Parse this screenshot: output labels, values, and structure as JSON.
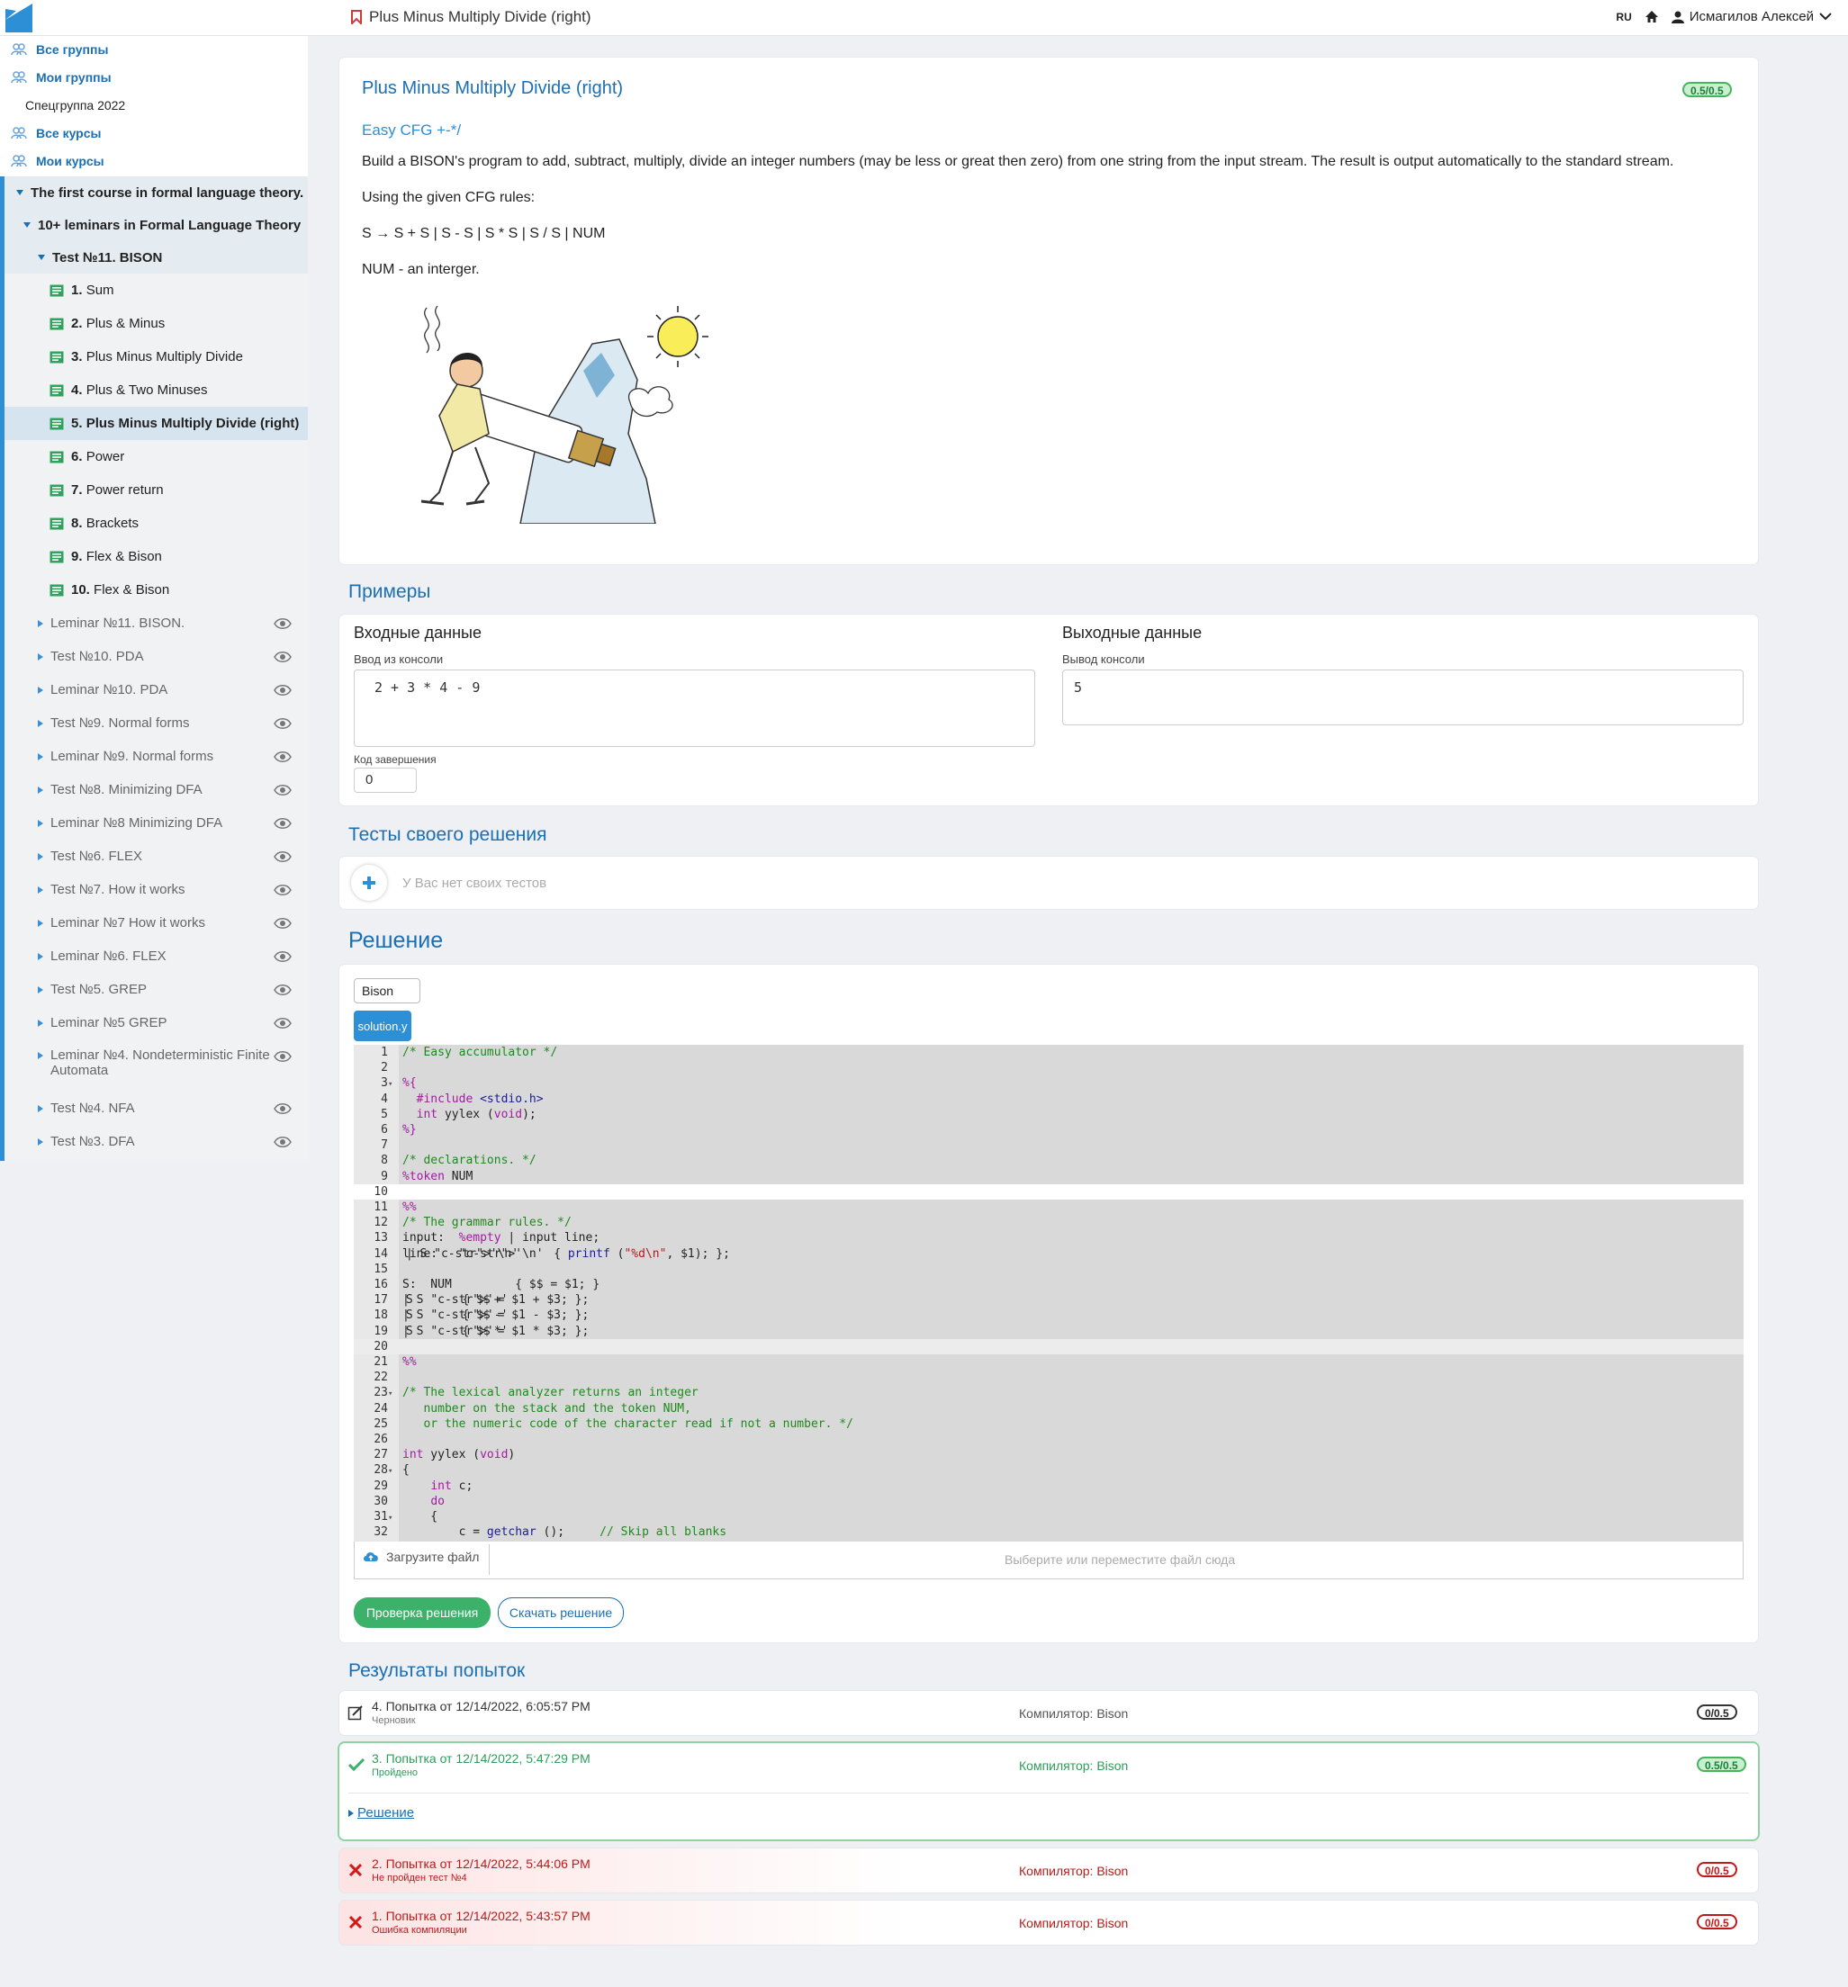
{
  "header": {
    "page_title": "Plus Minus Multiply Divide (right)",
    "lang": "RU",
    "user_name": "Исмагилов Алексей"
  },
  "sidebar": {
    "top_links": [
      "Все группы",
      "Мои группы"
    ],
    "group_name": "Спецгруппа 2022",
    "course_links": [
      "Все курсы",
      "Мои курсы"
    ],
    "course": "The first course in formal language theory.",
    "module": "10+ leminars in Formal Language Theory",
    "test": "Test №11. BISON",
    "tasks": [
      {
        "num": "1.",
        "name": "Sum"
      },
      {
        "num": "2.",
        "name": "Plus & Minus"
      },
      {
        "num": "3.",
        "name": "Plus Minus Multiply Divide"
      },
      {
        "num": "4.",
        "name": "Plus & Two Minuses"
      },
      {
        "num": "5.",
        "name": "Plus Minus Multiply Divide (right)"
      },
      {
        "num": "6.",
        "name": "Power"
      },
      {
        "num": "7.",
        "name": "Power return"
      },
      {
        "num": "8.",
        "name": "Brackets"
      },
      {
        "num": "9.",
        "name": "Flex & Bison"
      },
      {
        "num": "10.",
        "name": "Flex & Bison"
      }
    ],
    "other_items": [
      "Leminar №11. BISON.",
      "Test №10. PDA",
      "Leminar №10. PDA",
      "Test №9. Normal forms",
      "Leminar №9. Normal forms",
      "Test №8. Minimizing DFA",
      "Leminar №8 Minimizing DFA",
      "Test №6. FLEX",
      "Test №7. How it works",
      "Leminar №7 How it works",
      "Leminar №6. FLEX",
      "Test №5. GREP",
      "Leminar №5 GREP",
      "Leminar №4. Nondeterministic Finite",
      "Test №4. NFA",
      "Test №3. DFA"
    ],
    "other_item_wrap": "Automata"
  },
  "task": {
    "title": "Plus Minus Multiply Divide (right)",
    "score": "0.5/0.5",
    "subtitle": "Easy CFG +-*/",
    "description": "Build a BISON's program to add, subtract, multiply, divide an integer numbers (may be less or great then zero) from one string from the input stream. The result is output automatically to the standard stream.",
    "rules_intro": "Using the given CFG rules:",
    "rules": "S → S + S | S - S | S * S | S / S | NUM",
    "num_def": "NUM - an interger."
  },
  "examples": {
    "section_title": "Примеры",
    "input_head": "Входные данные",
    "input_label": "Ввод из консоли",
    "input_value": "2 + 3 * 4 - 9",
    "exit_code_label": "Код завершения",
    "exit_code": "0",
    "output_head": "Выходные данные",
    "output_label": "Вывод консоли",
    "output_value": "5"
  },
  "own_tests": {
    "section_title": "Тесты своего решения",
    "empty_text": "У Вас нет своих тестов"
  },
  "solution": {
    "section_title": "Решение",
    "language": "Bison",
    "file_tab": "solution.y",
    "upload_label": "Загрузите файл",
    "drop_placeholder": "Выберите или переместите файл сюда",
    "check_button": "Проверка решения",
    "download_button": "Скачать решение"
  },
  "code_lines": [
    {
      "n": "1",
      "f": "",
      "t": "/* Easy accumulator */"
    },
    {
      "n": "2",
      "f": "",
      "t": ""
    },
    {
      "n": "3",
      "f": "▾",
      "t": "%{"
    },
    {
      "n": "4",
      "f": "",
      "t": "  #include <stdio.h>"
    },
    {
      "n": "5",
      "f": "",
      "t": "  int yylex (void);"
    },
    {
      "n": "6",
      "f": "",
      "t": "%}"
    },
    {
      "n": "7",
      "f": "",
      "t": ""
    },
    {
      "n": "8",
      "f": "",
      "t": "/* declarations. */"
    },
    {
      "n": "9",
      "f": "",
      "t": "%token NUM"
    },
    {
      "n": "10",
      "f": "",
      "t": ""
    },
    {
      "n": "11",
      "f": "",
      "t": "%%"
    },
    {
      "n": "12",
      "f": "",
      "t": "/* The grammar rules. */"
    },
    {
      "n": "13",
      "f": "",
      "t": "input:  %empty | input line;"
    },
    {
      "n": "14",
      "f": "",
      "t": "line:   '\\n' | S '\\n'     { printf (\"%d\\n\", $1); };"
    },
    {
      "n": "15",
      "f": "",
      "t": ""
    },
    {
      "n": "16",
      "f": "",
      "t": "S:  NUM         { $$ = $1; }"
    },
    {
      "n": "17",
      "f": "",
      "t": "| S '+' S       { $$ = $1 + $3; };"
    },
    {
      "n": "18",
      "f": "",
      "t": "| S '-' S       { $$ = $1 - $3; };"
    },
    {
      "n": "19",
      "f": "",
      "t": "| S '*' S       { $$ = $1 * $3; };"
    },
    {
      "n": "20",
      "f": "",
      "t": ""
    },
    {
      "n": "21",
      "f": "",
      "t": "%%"
    },
    {
      "n": "22",
      "f": "",
      "t": ""
    },
    {
      "n": "23",
      "f": "▾",
      "t": "/* The lexical analyzer returns an integer"
    },
    {
      "n": "24",
      "f": "",
      "t": "   number on the stack and the token NUM,"
    },
    {
      "n": "25",
      "f": "",
      "t": "   or the numeric code of the character read if not a number. */"
    },
    {
      "n": "26",
      "f": "",
      "t": ""
    },
    {
      "n": "27",
      "f": "",
      "t": "int yylex (void)"
    },
    {
      "n": "28",
      "f": "▾",
      "t": "{"
    },
    {
      "n": "29",
      "f": "",
      "t": "    int c;"
    },
    {
      "n": "30",
      "f": "",
      "t": "    do"
    },
    {
      "n": "31",
      "f": "▾",
      "t": "    {"
    },
    {
      "n": "32",
      "f": "",
      "t": "        c = getchar ();     // Skip all blanks"
    }
  ],
  "results": {
    "section_title": "Результаты попыток",
    "attempts": [
      {
        "title": "4. Попытка от 12/14/2022, 6:05:57 PM",
        "status": "Черновик",
        "compiler": "Компилятор: Bison",
        "score": "0/0.5"
      },
      {
        "title": "3. Попытка от 12/14/2022, 5:47:29 PM",
        "status": "Пройдено",
        "compiler": "Компилятор: Bison",
        "score": "0.5/0.5",
        "link": "Решение"
      },
      {
        "title": "2. Попытка от 12/14/2022, 5:44:06 PM",
        "status": "Не пройден тест №4",
        "compiler": "Компилятор: Bison",
        "score": "0/0.5"
      },
      {
        "title": "1. Попытка от 12/14/2022, 5:43:57 PM",
        "status": "Ошибка компиляции",
        "compiler": "Компилятор: Bison",
        "score": "0/0.5"
      }
    ]
  },
  "colors": {
    "accent": "#1a6fb5",
    "success": "#3bb16a",
    "error": "#c01818"
  }
}
